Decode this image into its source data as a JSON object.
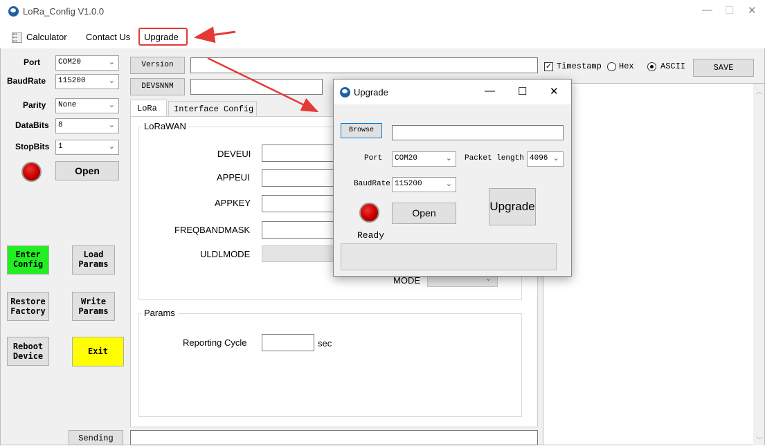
{
  "window": {
    "title": "LoRa_Config V1.0.0",
    "controls": {
      "minimize": "—",
      "maximize": "☐",
      "close": "✕"
    }
  },
  "menu": {
    "items": [
      "Calculator",
      "Contact Us",
      "Upgrade"
    ]
  },
  "serial": {
    "port_label": "Port",
    "port_value": "COM20",
    "baud_label": "BaudRate",
    "baud_value": "115200",
    "parity_label": "Parity",
    "parity_value": "None",
    "databits_label": "DataBits",
    "databits_value": "8",
    "stopbits_label": "StopBits",
    "stopbits_value": "1",
    "open_label": "Open"
  },
  "actions": {
    "enter_config": "Enter Config",
    "load_params": "Load Params",
    "restore_factory": "Restore Factory",
    "write_params": "Write Params",
    "reboot_device": "Reboot Device",
    "exit": "Exit",
    "sending": "Sending"
  },
  "info": {
    "version_label": "Version",
    "devsnnm_label": "DEVSNNM"
  },
  "tabs": [
    "LoRa",
    "Interface Config"
  ],
  "lorawan": {
    "group_title": "LoRaWAN",
    "deveui": "DEVEUI",
    "appeui": "APPEUI",
    "appkey": "APPKEY",
    "freqbandmask": "FREQBANDMASK",
    "uldlmode": "ULDLMODE",
    "mode": "MODE"
  },
  "params": {
    "group_title": "Params",
    "reporting_cycle": "Reporting Cycle",
    "unit": "sec"
  },
  "log": {
    "timestamp_label": "Timestamp",
    "hex_label": "Hex",
    "ascii_label": "ASCII",
    "save_label": "SAVE",
    "timestamp_checked": true,
    "format_selected": "ASCII"
  },
  "upgrade_dialog": {
    "title": "Upgrade",
    "browse": "Browse",
    "port_label": "Port",
    "port_value": "COM20",
    "packet_length_label": "Packet length",
    "packet_length_value": "4096",
    "baud_label": "BaudRate",
    "baud_value": "115200",
    "open_label": "Open",
    "upgrade_label": "Upgrade",
    "status": "Ready"
  },
  "colors": {
    "enter_config_bg": "#22ee22",
    "exit_bg": "#ffff00",
    "annotation_red": "#e53935"
  }
}
